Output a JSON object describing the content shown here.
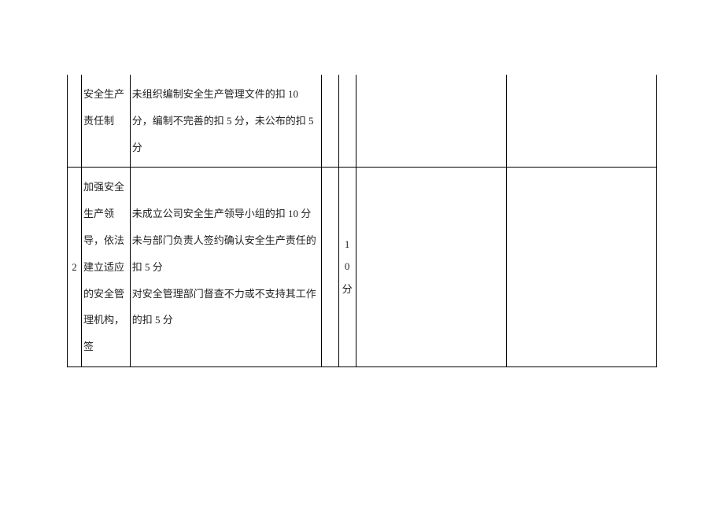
{
  "rows": [
    {
      "col1": "",
      "col2": "安全生产责任制",
      "col3": "未组织编制安全生产管理文件的扣 10 分，编制不完善的扣 5 分，未公布的扣 5 分",
      "col4": "",
      "col5": "",
      "col6": "",
      "col7": ""
    },
    {
      "col1": "2",
      "col2": "加强安全生产领导，依法建立适应的安全管理机构，签",
      "col3": "未成立公司安全生产领导小组的扣 10 分\n未与部门负责人签约确认安全生产责任的扣 5 分\n对安全管理部门督查不力或不支持其工作的扣 5 分",
      "col4": "",
      "col5": "1\n0\n分",
      "col6": "",
      "col7": ""
    }
  ]
}
